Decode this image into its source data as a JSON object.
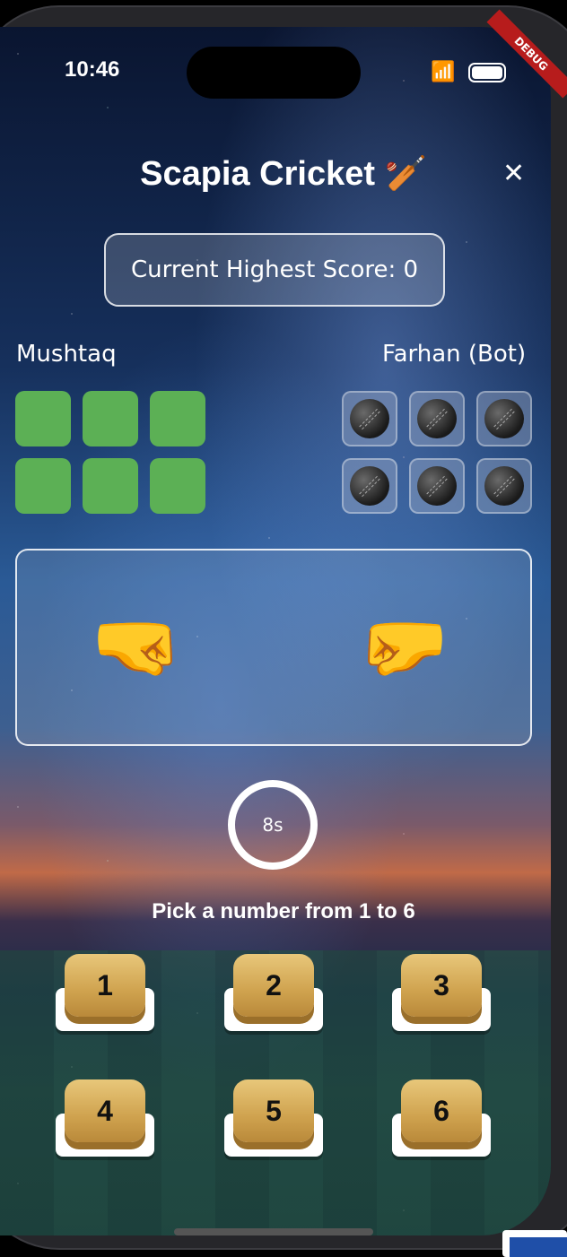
{
  "status_bar": {
    "time": "10:46",
    "debug_label": "DEBUG"
  },
  "header": {
    "title": "Scapia Cricket 🏏",
    "close_symbol": "✕"
  },
  "score": {
    "label": "Current Highest Score: 0"
  },
  "players": {
    "left": {
      "name": "Mushtaq",
      "cells": [
        "green",
        "green",
        "green",
        "green",
        "green",
        "green"
      ]
    },
    "right": {
      "name": "Farhan (Bot)",
      "cells": [
        "ball",
        "ball",
        "ball",
        "ball",
        "ball",
        "ball"
      ]
    }
  },
  "hands": {
    "left_icon": "fist-icon",
    "right_icon": "fist-icon",
    "left_glyph": "🤜",
    "right_glyph": "🤜"
  },
  "timer": {
    "value": "8s"
  },
  "prompt": "Pick a number from 1 to 6",
  "numbers": [
    "1",
    "2",
    "3",
    "4",
    "5",
    "6"
  ],
  "colors": {
    "green": "#5cb055",
    "gold": "#cfa24e"
  }
}
